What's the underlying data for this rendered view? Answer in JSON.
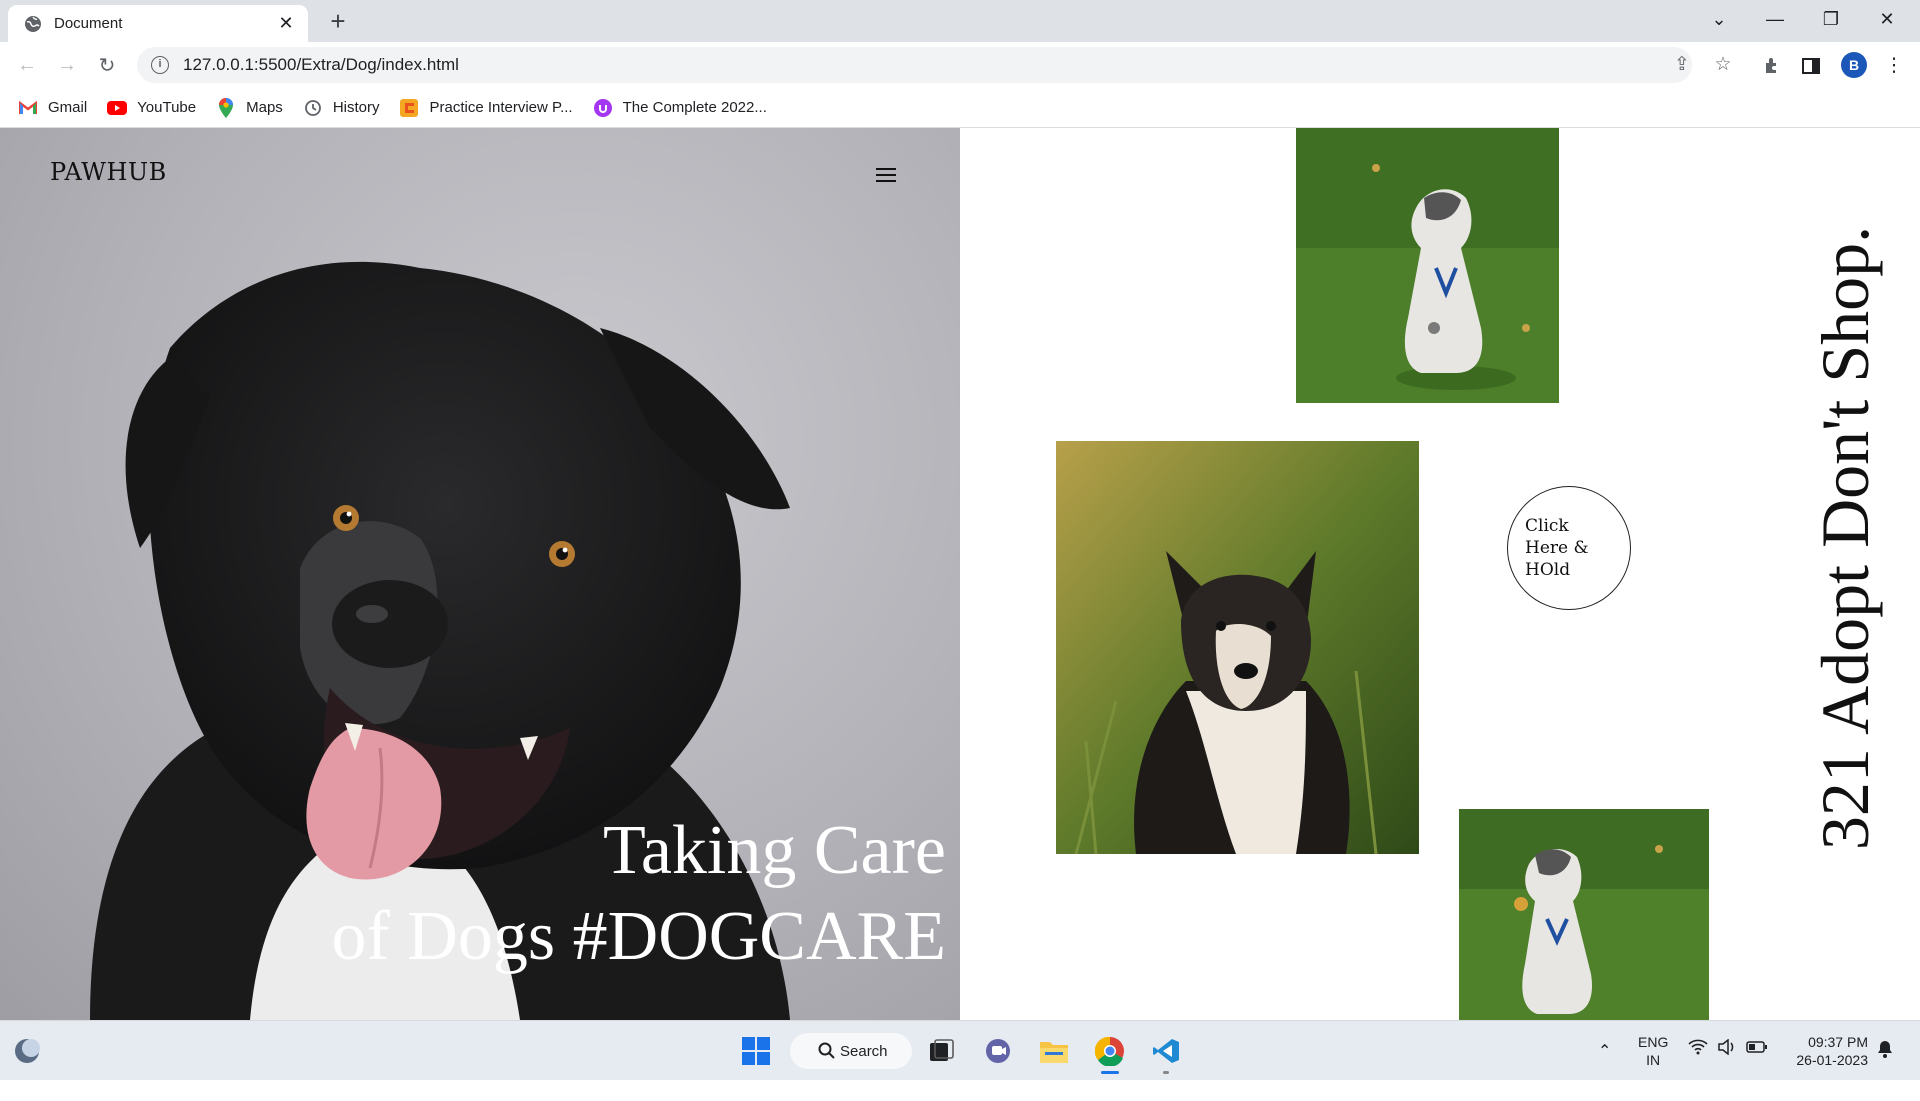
{
  "browser": {
    "tab_title": "Document",
    "url": "127.0.0.1:5500/Extra/Dog/index.html",
    "profile_initial": "B",
    "bookmarks": [
      {
        "label": "Gmail",
        "icon": "gmail-icon"
      },
      {
        "label": "YouTube",
        "icon": "youtube-icon"
      },
      {
        "label": "Maps",
        "icon": "maps-icon"
      },
      {
        "label": "History",
        "icon": "history-icon"
      },
      {
        "label": "Practice Interview P...",
        "icon": "coding-icon"
      },
      {
        "label": "The Complete 2022...",
        "icon": "udemy-icon"
      }
    ]
  },
  "page": {
    "brand": "PAWHUB",
    "hero_line1": "Taking Care",
    "hero_line2": "of Dogs #DOGCARE",
    "cta_label": "Click Here & HOld",
    "vertical_tagline": "321 Adopt Don't Shop."
  },
  "taskbar": {
    "search_label": "Search",
    "lang_line1": "ENG",
    "lang_line2": "IN",
    "time": "09:37 PM",
    "date": "26-01-2023"
  },
  "colors": {
    "chrome_bg": "#dee1e6",
    "hero_bg": "#b2b2b8",
    "accent_profile": "#1a57b8"
  }
}
